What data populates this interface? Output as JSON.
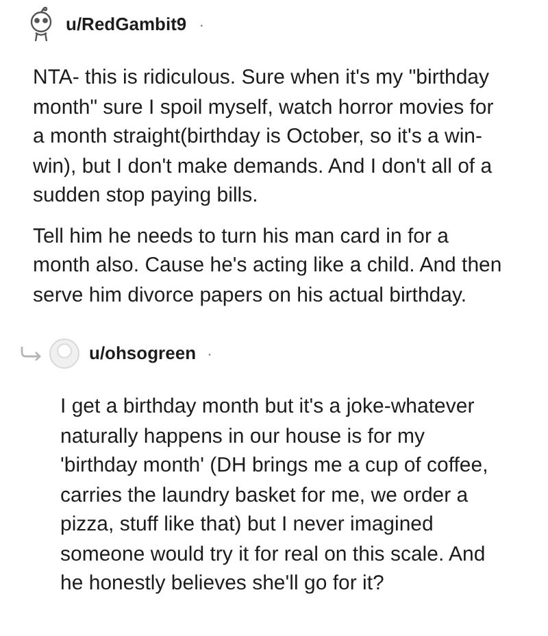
{
  "comments": [
    {
      "username": "u/RedGambit9",
      "separator": "·",
      "kind": "comment",
      "paragraphs": [
        "NTA- this is ridiculous. Sure when it's my \"birthday month\" sure I spoil myself, watch horror movies for a month straight(birthday is October, so it's a win-win), but I don't make demands. And I don't all of a sudden stop paying bills.",
        "Tell him he needs to turn his man card in for a month also. Cause he's acting like a child. And then serve him divorce papers on his actual birthday."
      ]
    },
    {
      "username": "u/ohsogreen",
      "separator": "·",
      "kind": "reply",
      "paragraphs": [
        "I get a birthday month but it's a joke-whatever naturally happens in our house is for my 'birthday month' (DH brings me a cup of coffee, carries the laundry basket for me, we order a pizza, stuff like that) but I never imagined someone would try it for real on this scale. And he honestly believes she'll go for it?"
      ]
    }
  ]
}
